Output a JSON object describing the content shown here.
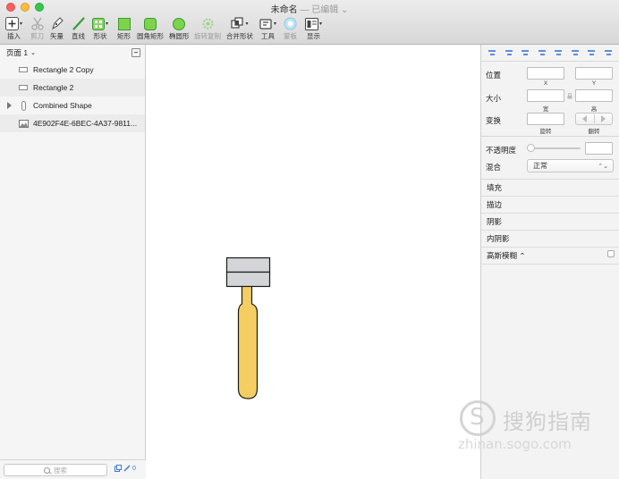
{
  "window": {
    "title": "未命名",
    "subtitle": "— 已编辑 ⌄"
  },
  "toolbar": {
    "insert": "插入",
    "cut": "剪刀",
    "vector": "矢量",
    "line": "直线",
    "shape": "形状",
    "rectangle": "矩形",
    "rounded_rect": "圆角矩形",
    "oval": "椭圆形",
    "rotate_copy": "旋转复制",
    "combine": "合并形状",
    "tools": "工具",
    "mask": "蒙板",
    "display": "显示"
  },
  "layers": {
    "page_label": "页面 1",
    "items": [
      {
        "name": "Rectangle 2 Copy",
        "icon": "rectangle-layer-icon"
      },
      {
        "name": "Rectangle 2",
        "icon": "rectangle-layer-icon"
      },
      {
        "name": "Combined Shape",
        "icon": "combined-shape-icon"
      },
      {
        "name": "4E902F4E-6BEC-4A37-9811...",
        "icon": "image-layer-icon"
      }
    ],
    "search_placeholder": "搜索",
    "bottom_count": "0"
  },
  "inspector": {
    "position": "位置",
    "x": "X",
    "y": "Y",
    "size": "大小",
    "width": "宽",
    "height": "高",
    "transform": "变换",
    "rotate": "旋转",
    "flip": "翻转",
    "opacity": "不透明度",
    "blend": "混合",
    "blend_value": "正常",
    "fill": "填充",
    "border": "描边",
    "shadow": "阴影",
    "inner_shadow": "内阴影",
    "gaussian_blur": "高斯模糊 ⌃"
  },
  "watermark": {
    "text": "搜狗指南",
    "url": "zhinan.sogo.com"
  },
  "colors": {
    "handle_fill": "#f5ce63",
    "head_fill": "#d4d5d8",
    "stroke": "#1a1a1a"
  }
}
